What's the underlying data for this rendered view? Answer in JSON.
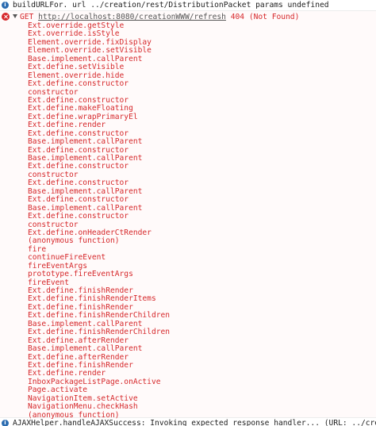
{
  "console": {
    "info_line_1": {
      "icon": "info-icon",
      "text": "buildURLFor. url ../creation/rest/DistributionPacket params undefined"
    },
    "error": {
      "icon": "error-icon",
      "method": "GET",
      "url": "http://localhost:8080/creationWWW/refresh",
      "status": "404 (Not Found)",
      "stack": [
        "Ext.override.getStyle",
        "Ext.override.isStyle",
        "Element.override.fixDisplay",
        "Element.override.setVisible",
        "Base.implement.callParent",
        "Ext.define.setVisible",
        "Element.override.hide",
        "Ext.define.constructor",
        "constructor",
        "Ext.define.constructor",
        "Ext.define.makeFloating",
        "Ext.define.wrapPrimaryEl",
        "Ext.define.render",
        "Ext.define.constructor",
        "Base.implement.callParent",
        "Ext.define.constructor",
        "Base.implement.callParent",
        "Ext.define.constructor",
        "constructor",
        "Ext.define.constructor",
        "Base.implement.callParent",
        "Ext.define.constructor",
        "Base.implement.callParent",
        "Ext.define.constructor",
        "constructor",
        "Ext.define.onHeaderCtRender",
        "(anonymous function)",
        "fire",
        "continueFireEvent",
        "fireEventArgs",
        "prototype.fireEventArgs",
        "fireEvent",
        "Ext.define.finishRender",
        "Ext.define.finishRenderItems",
        "Ext.define.finishRender",
        "Ext.define.finishRenderChildren",
        "Base.implement.callParent",
        "Ext.define.finishRenderChildren",
        "Ext.define.afterRender",
        "Base.implement.callParent",
        "Ext.define.afterRender",
        "Ext.define.finishRender",
        "Ext.define.render",
        "InboxPackageListPage.onActive",
        "Page.activate",
        "NavigationItem.setActive",
        "NavigationMenu.checkHash",
        "(anonymous function)"
      ]
    },
    "info_line_2": {
      "icon": "info-icon",
      "text": "AJAXHelper.handleAJAXSuccess: Invoking expected response handler... (URL: ../creat"
    }
  },
  "colors": {
    "error_red": "#d6282b",
    "info_blue": "#2b6cb0",
    "error_bg": "#fffafa"
  }
}
